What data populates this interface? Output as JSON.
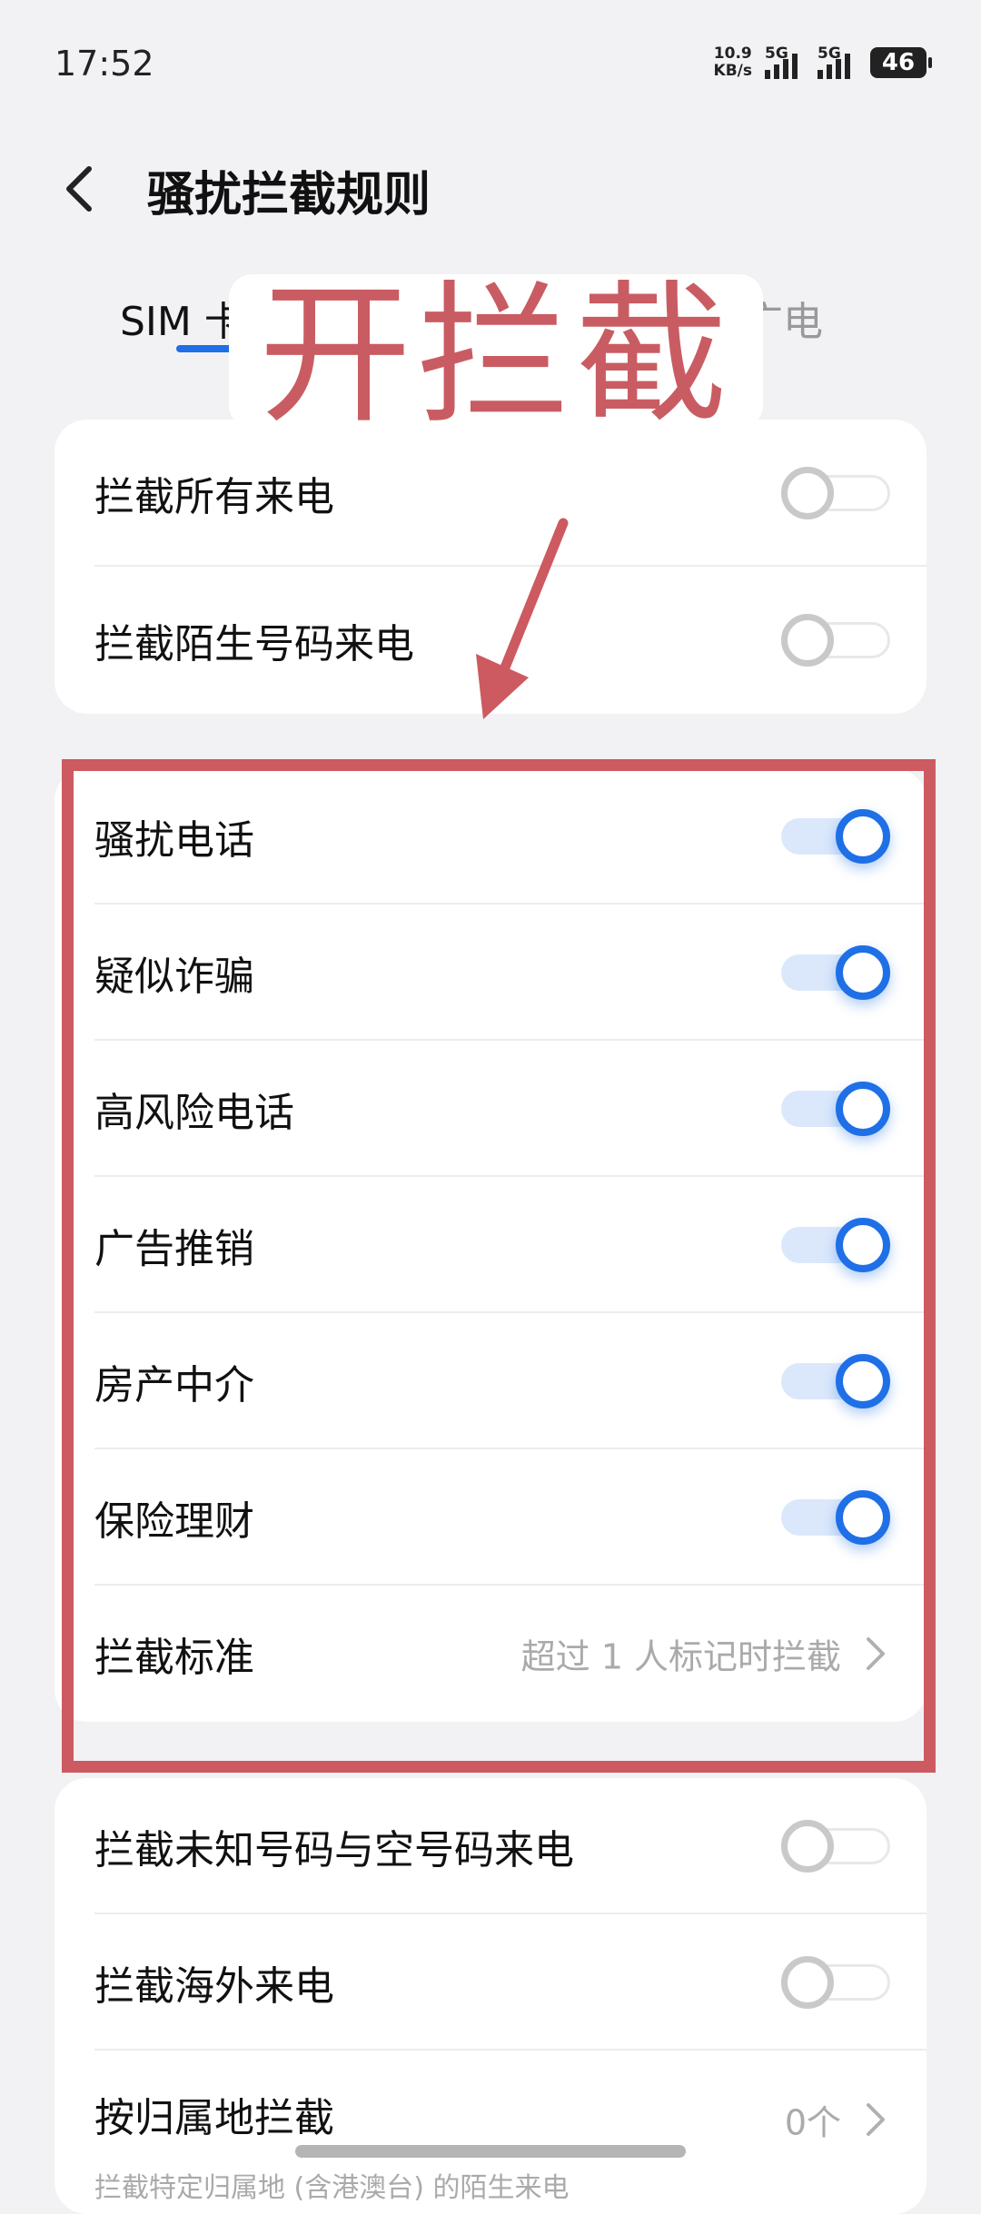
{
  "status_bar": {
    "time": "17:52",
    "net_speed_value": "10.9",
    "net_speed_unit": "KB/s",
    "sim1_network": "5G",
    "sim2_network": "5G",
    "battery": "46"
  },
  "header": {
    "back_icon": "chevron-left-icon",
    "title": "骚扰拦截规则"
  },
  "tabs": [
    {
      "label": "SIM 卡",
      "selected": true
    },
    {
      "label": "广电",
      "selected": false
    }
  ],
  "annotation": {
    "banner_text": "开拦截",
    "color": "#cc5a60"
  },
  "colors": {
    "accent": "#1f6fe6",
    "annotation_red": "#cc5a60"
  },
  "group_basic": [
    {
      "label": "拦截所有来电",
      "on": false
    },
    {
      "label": "拦截陌生号码来电",
      "on": false
    }
  ],
  "group_categories": [
    {
      "label": "骚扰电话",
      "on": true
    },
    {
      "label": "疑似诈骗",
      "on": true
    },
    {
      "label": "高风险电话",
      "on": true
    },
    {
      "label": "广告推销",
      "on": true
    },
    {
      "label": "房产中介",
      "on": true
    },
    {
      "label": "保险理财",
      "on": true
    }
  ],
  "criteria": {
    "label": "拦截标准",
    "value": "超过 1 人标记时拦截"
  },
  "group_more": [
    {
      "label": "拦截未知号码与空号码来电",
      "on": false
    },
    {
      "label": "拦截海外来电",
      "on": false
    }
  ],
  "region": {
    "label": "按归属地拦截",
    "value": "0个",
    "subtitle": "拦截特定归属地 (含港澳台) 的陌生来电"
  }
}
